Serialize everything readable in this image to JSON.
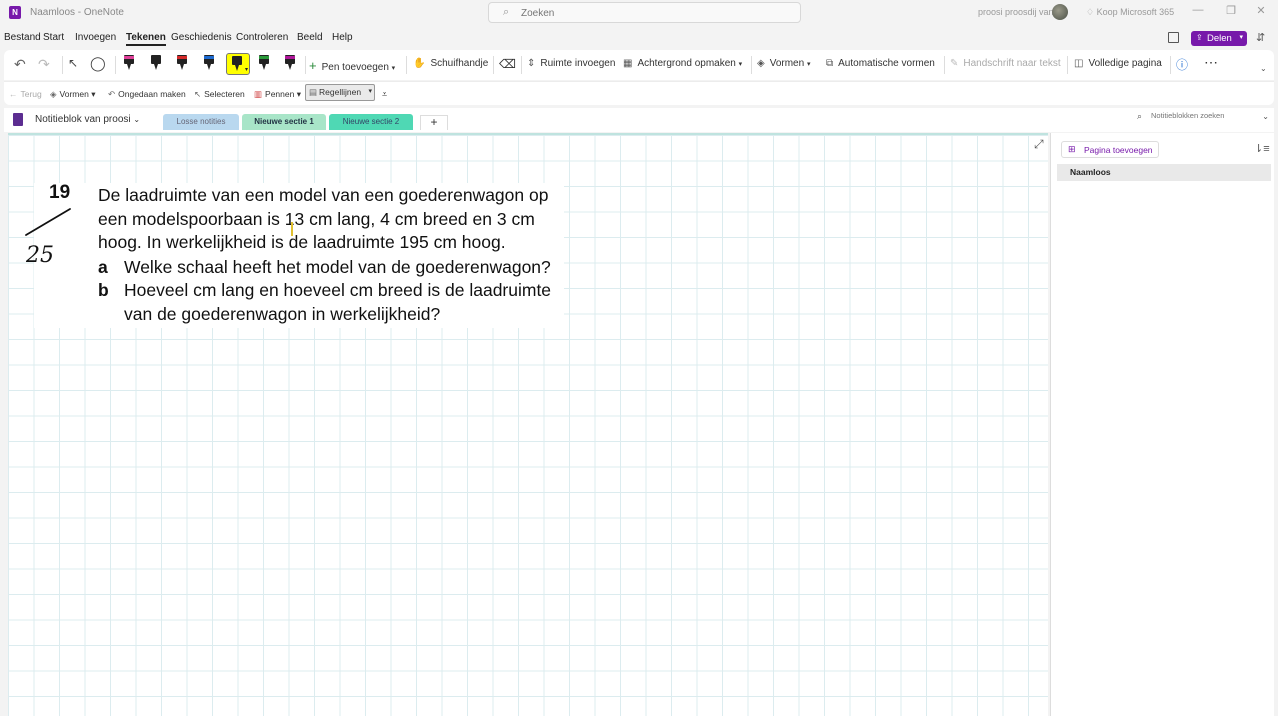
{
  "window": {
    "title": "Naamloos - OneNote",
    "search_placeholder": "Zoeken",
    "user_name": "proosi proosdij van",
    "buy_label": "Koop Microsoft 365"
  },
  "menu": {
    "items": [
      "Bestand",
      "Start",
      "Invoegen",
      "Tekenen",
      "Geschiedenis",
      "Controleren",
      "Beeld",
      "Help"
    ],
    "active": "Tekenen",
    "share_label": "Delen"
  },
  "ribbon": {
    "pens": [
      {
        "color": "#e0409a"
      },
      {
        "color": "#222222"
      },
      {
        "color": "#d42a2a"
      },
      {
        "color": "#1e6bd1"
      },
      {
        "color": "#ffff00",
        "selected": true
      },
      {
        "color": "#2a9a3a"
      },
      {
        "color": "#b0179a"
      }
    ],
    "add_pen": "Pen toevoegen",
    "hand": "Schuifhandje",
    "insert_space": "Ruimte invoegen",
    "background": "Achtergrond opmaken",
    "shapes": "Vormen",
    "auto_shapes": "Automatische vormen",
    "ink_to_text": "Handschrift naar tekst",
    "full_page": "Volledige pagina"
  },
  "toolbar2": {
    "back": "Terug",
    "shapes": "Vormen",
    "undo": "Ongedaan maken",
    "select": "Selecteren",
    "pens": "Pennen",
    "rule_lines": "Regellijnen"
  },
  "sections": {
    "notebook_name": "Notitieblok van proosi",
    "tabs": [
      {
        "label": "Losse notities",
        "color": "#b9d8ef",
        "text_color": "#667"
      },
      {
        "label": "Nieuwe sectie 1",
        "color": "#a8e5c8",
        "text_color": "#234",
        "active": true
      },
      {
        "label": "Nieuwe sectie 2",
        "color": "#4fd8b4",
        "text_color": "#346"
      }
    ],
    "add": "+",
    "search_placeholder": "Notitieblokken zoeken"
  },
  "note": {
    "number": "19",
    "lines": [
      "De laadruimte van een model van een goederenwagon op",
      "een modelspoorbaan is 13 cm lang, 4 cm breed en 3 cm",
      "hoog. In werkelijkheid is de laadruimte 195 cm hoog."
    ],
    "sub_a_label": "a",
    "sub_a": "Welke schaal heeft het model van de goederenwagon?",
    "sub_b_label": "b",
    "sub_b_lines": [
      "Hoeveel cm lang en hoeveel cm breed is de laadruimte",
      "van de goederenwagon in werkelijkheid?"
    ],
    "handwritten_score": "25"
  },
  "pages": {
    "add_label": "Pagina toevoegen",
    "items": [
      "Naamloos"
    ]
  }
}
